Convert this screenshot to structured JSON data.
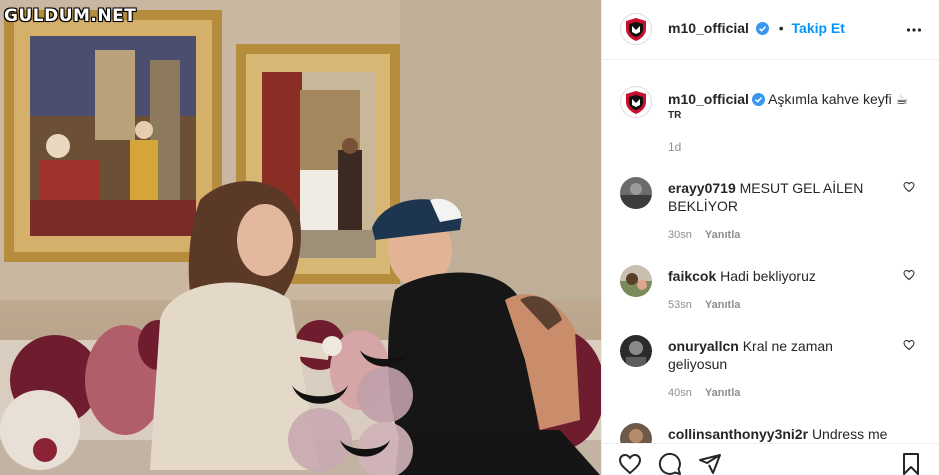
{
  "watermark": "GULDUM.NET",
  "post": {
    "username": "m10_official",
    "follow_separator": "•",
    "follow_label": "Takip Et",
    "caption_text": "Aşkımla kahve keyfi",
    "caption_emoji": "☕",
    "language_tag": "TR",
    "time_ago": "1d"
  },
  "comments": [
    {
      "username": "erayy0719",
      "text": "MESUT GEL AİLEN BEKLİYOR",
      "time": "30sn",
      "reply_label": "Yanıtla"
    },
    {
      "username": "faikcok",
      "text": "Hadi bekliyoruz",
      "time": "53sn",
      "reply_label": "Yanıtla"
    },
    {
      "username": "onuryallcn",
      "text": "Kral ne zaman geliyosun",
      "time": "40sn",
      "reply_label": "Yanıtla"
    },
    {
      "username": "collinsanthonyy3ni2r",
      "text": "Undress me",
      "time": "",
      "reply_label": ""
    }
  ],
  "icons": {
    "like": "heart-icon",
    "comment": "comment-icon",
    "share": "share-icon",
    "save": "bookmark-icon",
    "more": "more-options-icon",
    "verified": "verified-badge-icon"
  },
  "colors": {
    "accent": "#0095f6",
    "verified": "#3897f0",
    "muted": "#8e8e8e",
    "text": "#262626"
  }
}
